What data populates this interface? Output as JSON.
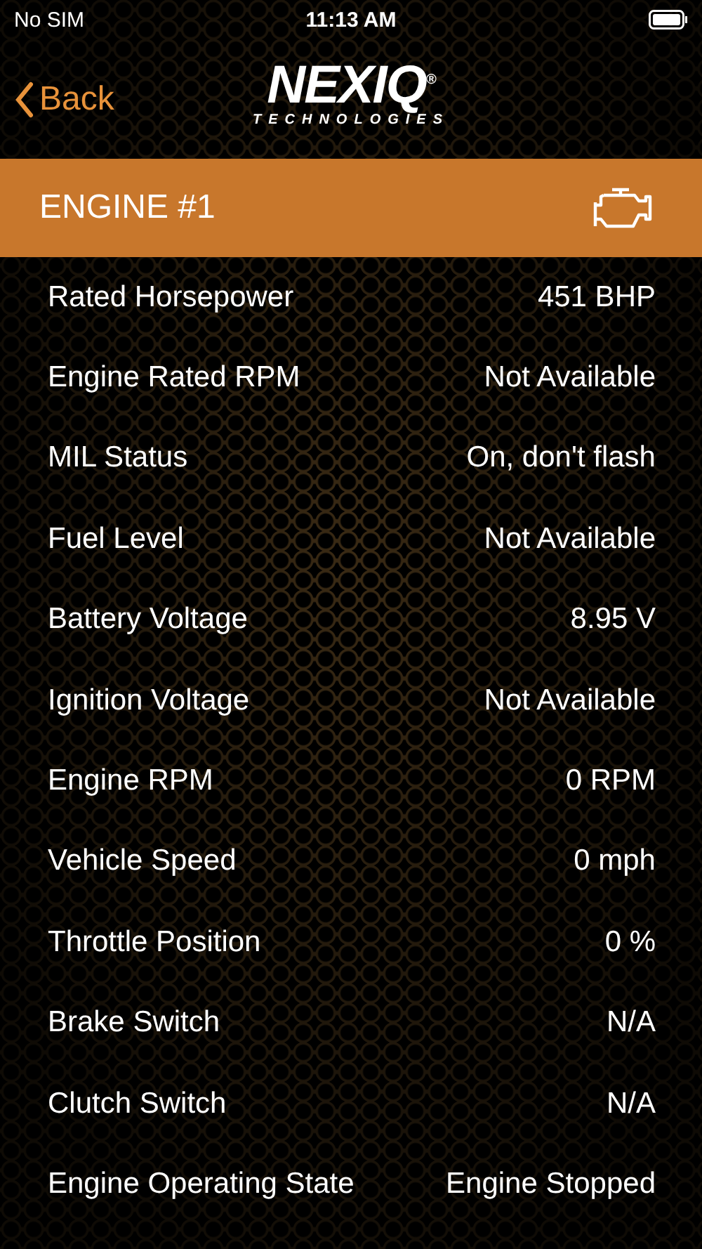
{
  "status_bar": {
    "carrier": "No SIM",
    "time": "11:13 AM"
  },
  "nav": {
    "back": "Back",
    "logo": {
      "brand": "NEXIQ",
      "sub": "TECHNOLOGIES",
      "mark": "®"
    }
  },
  "section": {
    "title": "ENGINE #1"
  },
  "rows": [
    {
      "label": "Rated Horsepower",
      "value": "451 BHP"
    },
    {
      "label": "Engine Rated RPM",
      "value": "Not Available"
    },
    {
      "label": "MIL Status",
      "value": "On, don't flash"
    },
    {
      "label": "Fuel Level",
      "value": "Not Available"
    },
    {
      "label": "Battery Voltage",
      "value": "8.95 V"
    },
    {
      "label": "Ignition Voltage",
      "value": "Not Available"
    },
    {
      "label": "Engine RPM",
      "value": "0 RPM"
    },
    {
      "label": "Vehicle Speed",
      "value": "0 mph"
    },
    {
      "label": "Throttle Position",
      "value": "0 %"
    },
    {
      "label": "Brake Switch",
      "value": "N/A"
    },
    {
      "label": "Clutch Switch",
      "value": "N/A"
    },
    {
      "label": "Engine Operating State",
      "value": "Engine Stopped"
    }
  ]
}
